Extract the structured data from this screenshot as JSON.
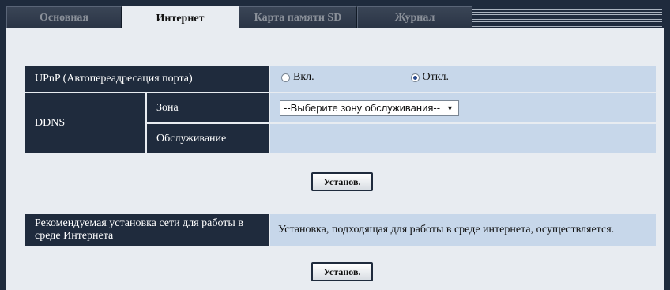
{
  "tabs": [
    {
      "label": "Основная"
    },
    {
      "label": "Интернет"
    },
    {
      "label": "Карта памяти SD"
    },
    {
      "label": "Журнал"
    }
  ],
  "upnp": {
    "label": "UPnP (Автопереадресация порта)",
    "on_label": "Вкл.",
    "off_label": "Откл.",
    "selected": "off"
  },
  "ddns": {
    "label": "DDNS",
    "zone_label": "Зона",
    "zone_value": "--Выберите зону обслуживания--",
    "service_label": "Обслуживание"
  },
  "set_button_label": "Установ.",
  "recommended": {
    "label": "Рекомендуемая установка сети для работы в среде Интернета",
    "value": "Установка, подходящая для работы в среде интернета, осуществляется.",
    "button_label": "Установ."
  }
}
